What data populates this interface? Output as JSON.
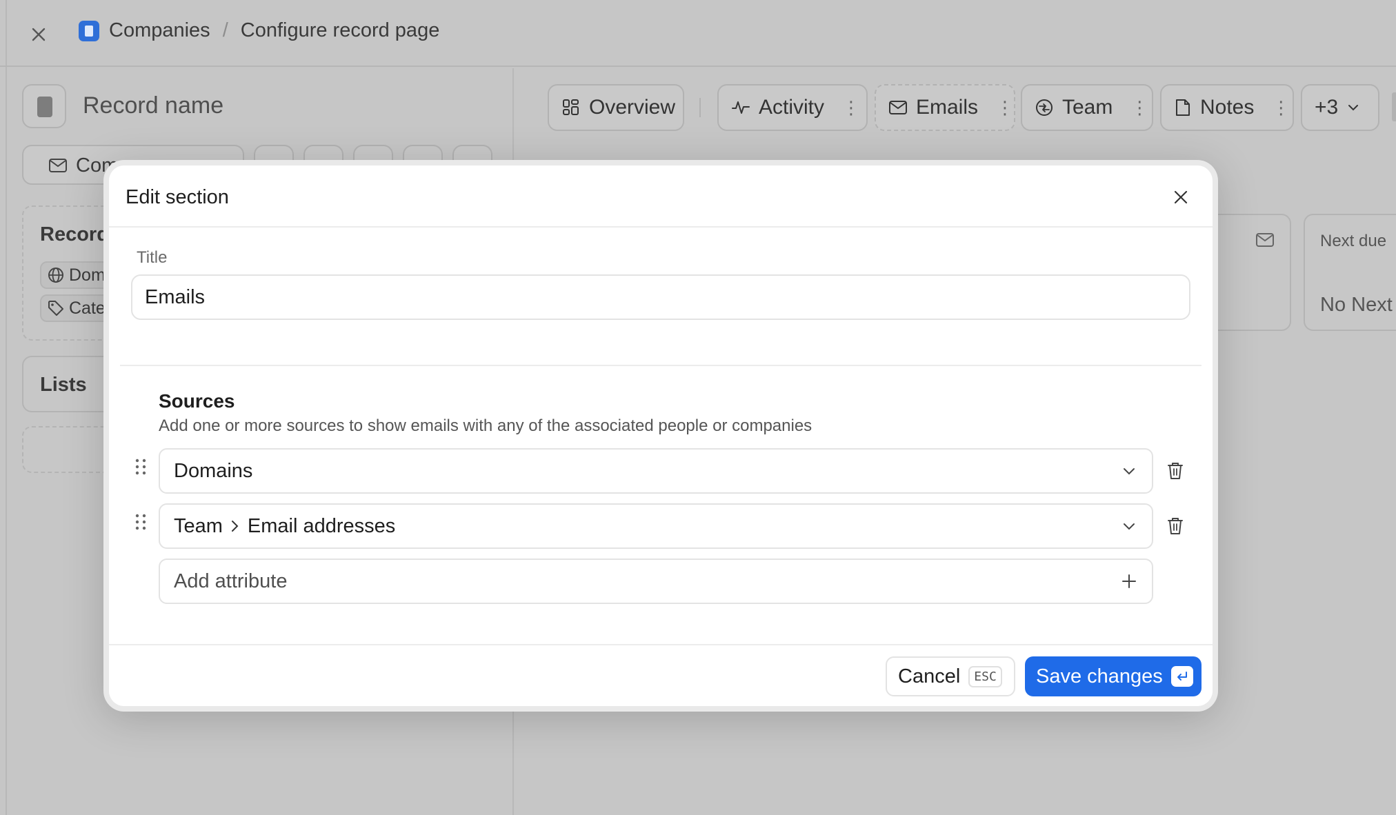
{
  "breadcrumb": {
    "object": "Companies",
    "page": "Configure record page"
  },
  "record": {
    "name_placeholder": "Record name",
    "compose_label_partial": "Com",
    "details_card_title": "Record",
    "attr_chips": [
      "Dom",
      "Cate"
    ],
    "lists_card_title": "Lists"
  },
  "tabs": [
    {
      "label": "Overview",
      "icon": "overview-grid-icon"
    },
    {
      "label": "Activity",
      "icon": "activity-icon"
    },
    {
      "label": "Emails",
      "icon": "mail-icon"
    },
    {
      "label": "Team",
      "icon": "team-icon"
    },
    {
      "label": "Notes",
      "icon": "note-icon"
    },
    {
      "label": "+3",
      "icon": "chevron-down-icon"
    }
  ],
  "background_cards": {
    "next_due_partial": "Next due",
    "no_next_partial": "No Next"
  },
  "modal": {
    "title": "Edit section",
    "title_field_label": "Title",
    "title_field_value": "Emails",
    "sources_heading": "Sources",
    "sources_description": "Add one or more sources to show emails with any of the associated people or companies",
    "sources": [
      {
        "parts": [
          "Domains"
        ]
      },
      {
        "parts": [
          "Team",
          "Email addresses"
        ]
      }
    ],
    "add_attribute_label": "Add attribute",
    "cancel_label": "Cancel",
    "cancel_shortcut": "ESC",
    "save_label": "Save changes"
  },
  "colors": {
    "primary": "#1f6be8",
    "overlay": "#c3c3c3"
  }
}
